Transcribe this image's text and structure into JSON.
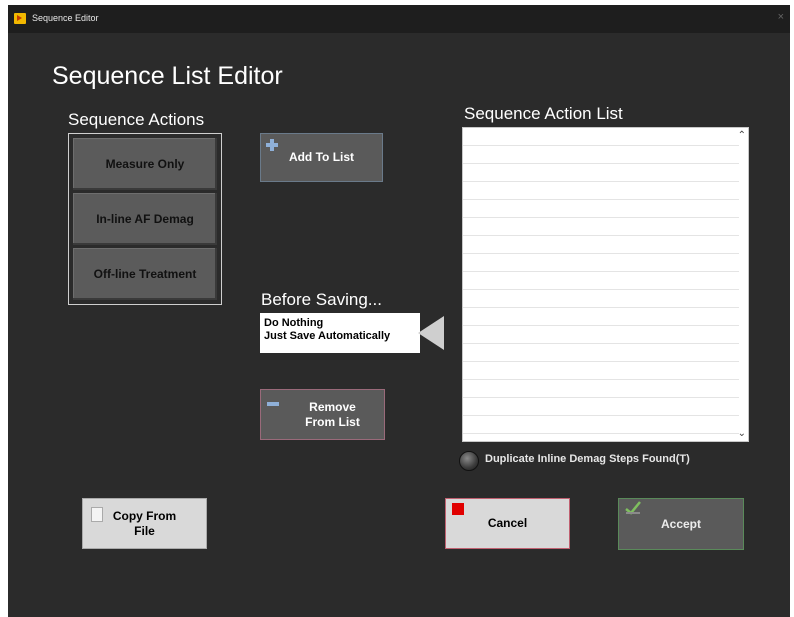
{
  "window": {
    "title": "Sequence Editor",
    "close_glyph": "×"
  },
  "heading": "Sequence List Editor",
  "actions": {
    "label": "Sequence Actions",
    "buttons": [
      "Measure Only",
      "In-line AF Demag",
      "Off-line Treatment"
    ]
  },
  "add_to_list": {
    "label": "Add To List",
    "icon": "plus-icon"
  },
  "before_saving": {
    "label": "Before Saving...",
    "options": [
      "Do Nothing",
      "Just Save Automatically"
    ]
  },
  "remove_from_list": {
    "label": "Remove From List",
    "icon": "minus-icon"
  },
  "action_list": {
    "label": "Sequence Action List",
    "items": []
  },
  "duplicate_indicator": {
    "label": "Duplicate Inline Demag Steps Found(T)",
    "state": "off"
  },
  "copy_from_file": {
    "label": "Copy From File",
    "icon": "document-icon"
  },
  "cancel": {
    "label": "Cancel",
    "icon": "stop-icon",
    "icon_color": "#e00000"
  },
  "accept": {
    "label": "Accept",
    "icon": "checkmark-icon"
  },
  "colors": {
    "background": "#2b2b2b",
    "text": "#ffffff",
    "button_grey": "#5a5a5a",
    "button_light": "#d9d9d9"
  }
}
